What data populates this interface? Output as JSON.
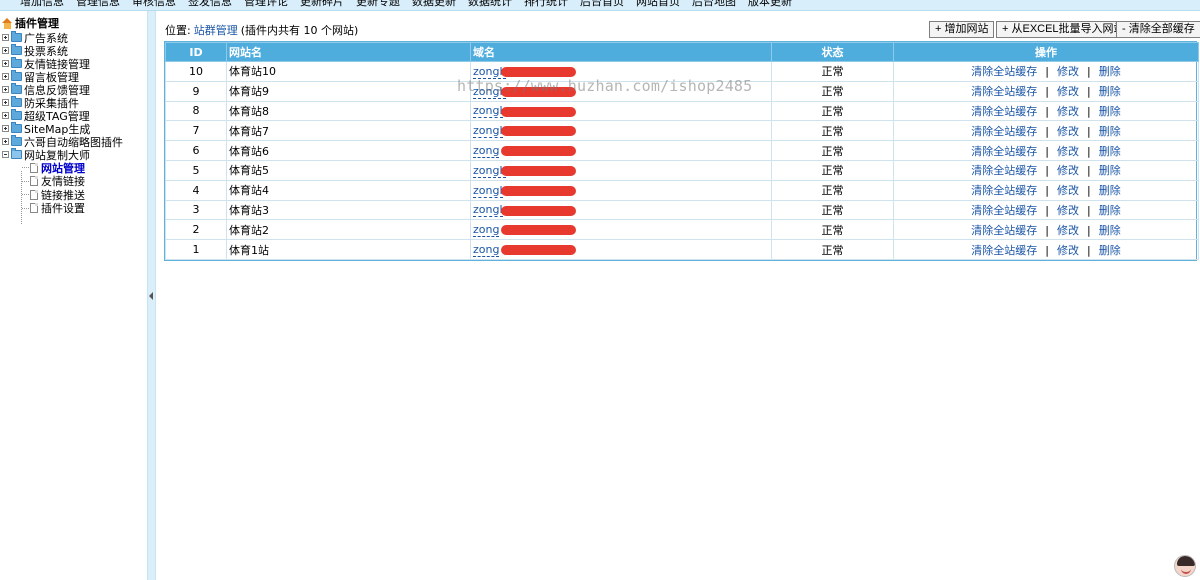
{
  "top_nav": [
    "增加信息",
    "管理信息",
    "审核信息",
    "签发信息",
    "管理评论",
    "更新碎片",
    "更新专题",
    "数据更新",
    "数据统计",
    "排行统计",
    "后台首页",
    "网站首页",
    "后台地图",
    "版本更新"
  ],
  "sidebar": {
    "root": "插件管理",
    "items": [
      "广告系统",
      "投票系统",
      "友情链接管理",
      "留言板管理",
      "信息反馈管理",
      "防采集插件",
      "超级TAG管理",
      "SiteMap生成",
      "六哥自动缩略图插件",
      "网站复制大师"
    ],
    "sub_items": [
      "网站管理",
      "友情链接",
      "链接推送",
      "插件设置"
    ]
  },
  "breadcrumb": {
    "prefix": "位置:",
    "link": "站群管理",
    "note": "(插件内共有 10 个网站)"
  },
  "toolbar": {
    "add_site": "+ 增加网站",
    "import_excel": "+ 从EXCEL批量导入网站",
    "clear_cache": "- 清除全部缓存"
  },
  "table": {
    "headers": [
      "ID",
      "网站名",
      "域名",
      "状态",
      "操作"
    ],
    "rows": [
      {
        "id": "10",
        "name": "体育站10",
        "domain": "zongh",
        "status": "正常"
      },
      {
        "id": "9",
        "name": "体育站9",
        "domain": "zongh",
        "status": "正常"
      },
      {
        "id": "8",
        "name": "体育站8",
        "domain": "zongl",
        "status": "正常"
      },
      {
        "id": "7",
        "name": "体育站7",
        "domain": "zongl",
        "status": "正常"
      },
      {
        "id": "6",
        "name": "体育站6",
        "domain": "zong",
        "status": "正常"
      },
      {
        "id": "5",
        "name": "体育站5",
        "domain": "zongh",
        "status": "正常"
      },
      {
        "id": "4",
        "name": "体育站4",
        "domain": "zongl",
        "status": "正常"
      },
      {
        "id": "3",
        "name": "体育站3",
        "domain": "zongl",
        "status": "正常"
      },
      {
        "id": "2",
        "name": "体育站2",
        "domain": "zong",
        "status": "正常"
      },
      {
        "id": "1",
        "name": "体育1站",
        "domain": "zong",
        "status": "正常"
      }
    ],
    "actions": {
      "clear": "清除全站缓存",
      "edit": "修改",
      "delete": "删除",
      "sep": "|"
    }
  },
  "watermark": "https://www.huzhan.com/ishop2485"
}
